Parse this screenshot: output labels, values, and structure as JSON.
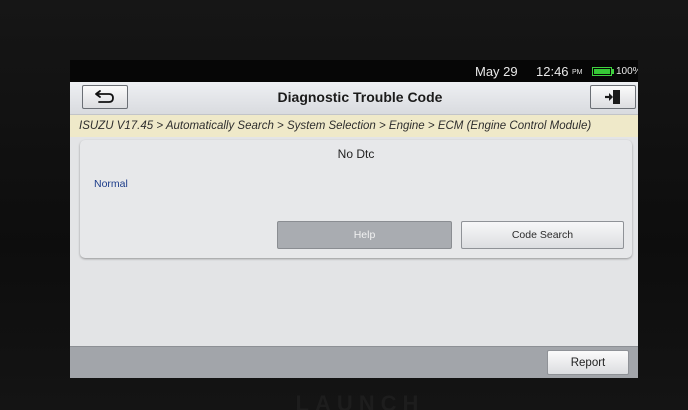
{
  "status_bar": {
    "date": "May 29",
    "time": "12:46",
    "ampm": "PM",
    "battery_text": "100%",
    "battery_level": 1.0,
    "battery_color": "#36c936"
  },
  "header": {
    "title": "Diagnostic Trouble Code",
    "back_icon": "back-arrow-icon",
    "exit_icon": "exit-door-icon"
  },
  "breadcrumb": "ISUZU V17.45 > Automatically Search > System Selection > Engine > ECM (Engine Control Module)",
  "result_card": {
    "title": "No Dtc",
    "status": "Normal",
    "help_label": "Help",
    "code_search_label": "Code Search"
  },
  "footer": {
    "report_label": "Report"
  },
  "device": {
    "brand": "LAUNCH"
  },
  "colors": {
    "breadcrumb_bg": "#efe9c9",
    "status_text": "#1c3c8a",
    "bottom_bar": "#a2a5aa"
  }
}
